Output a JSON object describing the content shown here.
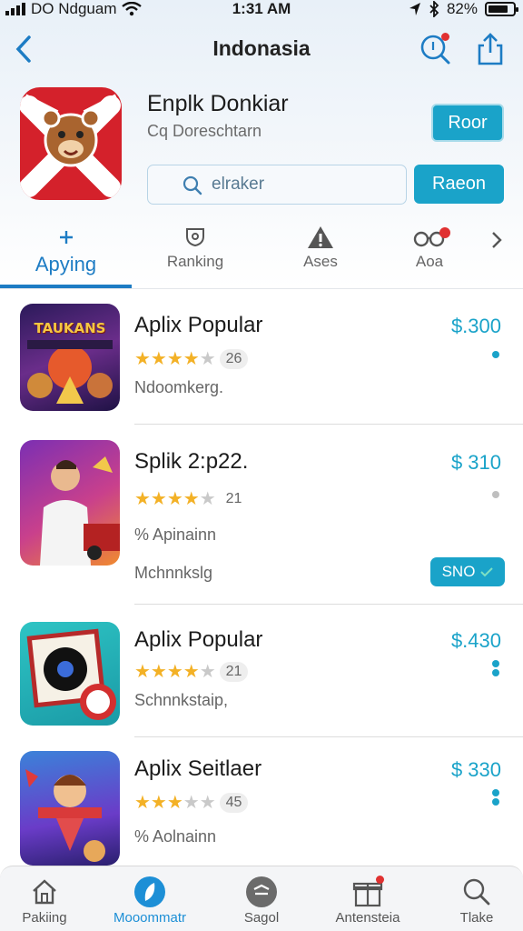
{
  "status": {
    "carrier": "DO Ndguam",
    "time": "1:31 AM",
    "battery": "82%"
  },
  "nav": {
    "title": "Indonasia"
  },
  "app": {
    "name": "Enplk Donkiar",
    "developer": "Cq Doreschtarn",
    "get_label": "Roor",
    "search_placeholder": "elraker",
    "search_button": "Raeon"
  },
  "tabs": [
    {
      "label": "Apying",
      "icon": "plus-icon"
    },
    {
      "label": "Ranking",
      "icon": "ranking-icon"
    },
    {
      "label": "Ases",
      "icon": "warning-icon"
    },
    {
      "label": "Aoa",
      "icon": "glasses-icon"
    }
  ],
  "list": [
    {
      "name": "Aplix Popular",
      "price": "$.300",
      "rating": 4,
      "count": "26",
      "lines": [
        "Ndoomkerg."
      ],
      "thumb_text": "TAUKANS"
    },
    {
      "name": "Splik 2:p22.",
      "price": "$ 310",
      "rating": 4,
      "count": "21",
      "lines": [
        "% Apinainn",
        "Mchnnkslg"
      ],
      "button": "SNO"
    },
    {
      "name": "Aplix Popular",
      "price": "$.430",
      "rating": 4,
      "count": "21",
      "lines": [
        "Schnnkstaip,"
      ]
    },
    {
      "name": "Aplix Seitlaer",
      "price": "$ 330",
      "rating": 3,
      "count": "45",
      "lines": [
        "% Aolnainn"
      ]
    }
  ],
  "bottom_tabs": [
    {
      "label": "Pakiing",
      "icon": "home-icon"
    },
    {
      "label": "Mooommatr",
      "icon": "discover-icon",
      "active": true
    },
    {
      "label": "Sagol",
      "icon": "games-icon"
    },
    {
      "label": "Antensteia",
      "icon": "gift-icon"
    },
    {
      "label": "Tlake",
      "icon": "search-icon"
    }
  ],
  "colors": {
    "accent": "#1aa3c9",
    "active_tab": "#1d7cc4",
    "star": "#f3b126"
  }
}
